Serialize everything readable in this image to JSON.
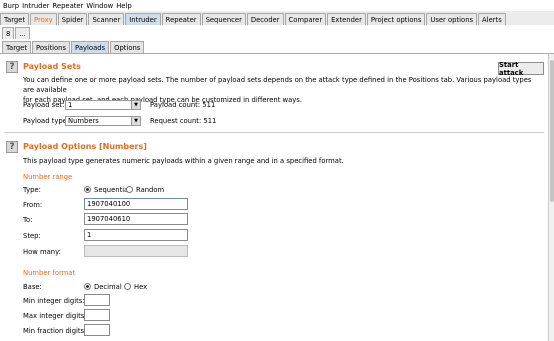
{
  "menu": [
    "Burp",
    "Intruder",
    "Repeater",
    "Window",
    "Help"
  ],
  "main_tabs": [
    {
      "label": "Target",
      "selected": false
    },
    {
      "label": "Proxy",
      "selected": false,
      "highlight": true
    },
    {
      "label": "Spider",
      "selected": false
    },
    {
      "label": "Scanner",
      "selected": false
    },
    {
      "label": "Intruder",
      "selected": true
    },
    {
      "label": "Repeater",
      "selected": false
    },
    {
      "label": "Sequencer",
      "selected": false
    },
    {
      "label": "Decoder",
      "selected": false
    },
    {
      "label": "Comparer",
      "selected": false
    },
    {
      "label": "Extender",
      "selected": false
    },
    {
      "label": "Project options",
      "selected": false
    },
    {
      "label": "User options",
      "selected": false
    },
    {
      "label": "Alerts",
      "selected": false
    }
  ],
  "attack_tabs": [
    "8",
    "..."
  ],
  "sub_tabs": [
    {
      "label": "Target",
      "selected": false
    },
    {
      "label": "Positions",
      "selected": false
    },
    {
      "label": "Payloads",
      "selected": true
    },
    {
      "label": "Options",
      "selected": false
    }
  ],
  "payload_sets": {
    "title": "Payload Sets",
    "description_line1": "You can define one or more payload sets. The number of payload sets depends on the attack type defined in the Positions tab. Various payload types are available",
    "description_line2": "for each payload set, and each payload type can be customized in different ways.",
    "start_attack_label": "Start attack",
    "set_label": "Payload set:",
    "set_value": "1",
    "type_label": "Payload type:",
    "type_value": "Numbers",
    "count_label": "Payload count: 511",
    "request_label": "Request count: 511"
  },
  "payload_options": {
    "title": "Payload Options [Numbers]",
    "description": "This payload type generates numeric payloads within a given range and in a specified format.",
    "range_heading": "Number range",
    "type_label": "Type:",
    "type_options": [
      {
        "label": "Sequential",
        "selected": true
      },
      {
        "label": "Random",
        "selected": false
      }
    ],
    "from_label": "From:",
    "from_value": "1907040100",
    "to_label": "To:",
    "to_value": "1907040610",
    "step_label": "Step:",
    "step_value": "1",
    "howmany_label": "How many:",
    "howmany_value": "",
    "format_heading": "Number format",
    "base_label": "Base:",
    "base_options": [
      {
        "label": "Decimal",
        "selected": true
      },
      {
        "label": "Hex",
        "selected": false
      }
    ],
    "min_int_label": "Min integer digits:",
    "max_int_label": "Max integer digits:",
    "min_frac_label": "Min fraction digits:"
  },
  "colors": {
    "accent": "#e86a1c",
    "selected_tab": "#cfdcea"
  }
}
